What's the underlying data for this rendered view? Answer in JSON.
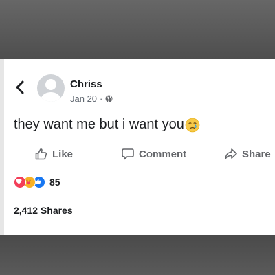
{
  "post": {
    "author": "Chriss",
    "date": "Jan 20",
    "separator": "·",
    "privacy_icon": "globe-icon",
    "text": "they want me but i want you",
    "emoji": "crying-face"
  },
  "actions": {
    "like_label": "Like",
    "comment_label": "Comment",
    "share_label": "Share"
  },
  "reactions": {
    "types": [
      "love",
      "care",
      "like"
    ],
    "count": "85"
  },
  "shares": {
    "label": "2,412 Shares"
  },
  "colors": {
    "love": "#f33e58",
    "care": "#f7b125",
    "like": "#1877f2",
    "text": "#1c1e21",
    "muted": "#65676b"
  }
}
